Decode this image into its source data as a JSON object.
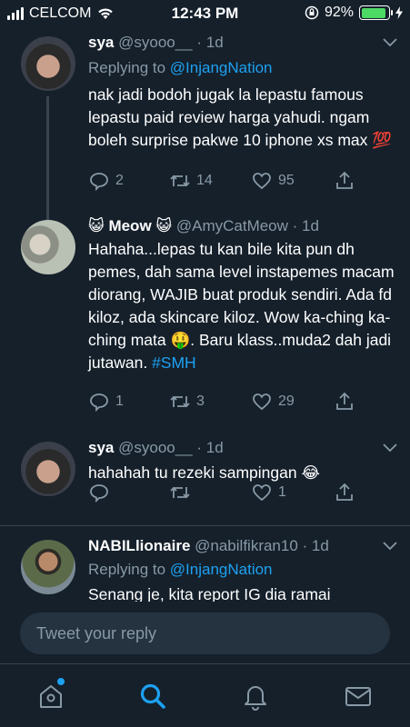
{
  "status_bar": {
    "carrier": "CELCOM",
    "time": "12:43 PM",
    "battery": "92%",
    "battery_level": 0.92
  },
  "tweets": [
    {
      "name": "sya",
      "handle": "@syooo__",
      "age": "· 1d",
      "replying_prefix": "Replying to",
      "replying_to": "@InjangNation",
      "text": "nak jadi bodoh jugak la lepastu famous lepastu paid review harga yahudi. ngam boleh surprise pakwe 10 iphone xs max 💯",
      "replies": "2",
      "retweets": "14",
      "likes": "95"
    },
    {
      "name": "😺 Meow 😺",
      "handle": "@AmyCatMeow",
      "age": "· 1d",
      "text": "Hahaha...lepas tu kan bile kita pun dh pemes, dah sama level instapemes macam diorang, WAJIB buat produk sendiri. Ada fd kiloz, ada skincare kiloz. Wow ka-ching ka-ching mata 🤑. Baru klass..muda2 dah jadi jutawan.",
      "hashtag": "#SMH",
      "replies": "1",
      "retweets": "3",
      "likes": "29"
    },
    {
      "name": "sya",
      "handle": "@syooo__",
      "age": "· 1d",
      "text": "hahahah tu rezeki sampingan 😂",
      "likes": "1"
    },
    {
      "name": "NABILlionaire",
      "handle": "@nabilfikran10",
      "age": "· 1d",
      "replying_prefix": "Replying to",
      "replying_to": "@InjangNation",
      "text": "Senang je, kita report IG dia ramai"
    }
  ],
  "compose": {
    "placeholder": "Tweet your reply"
  },
  "tabs": [
    {
      "icon": "home-icon",
      "active": false,
      "has_dot": true
    },
    {
      "icon": "search-icon",
      "active": true
    },
    {
      "icon": "notifications-icon",
      "active": false
    },
    {
      "icon": "messages-icon",
      "active": false
    }
  ],
  "colors": {
    "background": "#15202b",
    "accent": "#1da1f2",
    "secondary_text": "#8899a6",
    "divider": "#38444d",
    "battery": "#4cd964"
  }
}
